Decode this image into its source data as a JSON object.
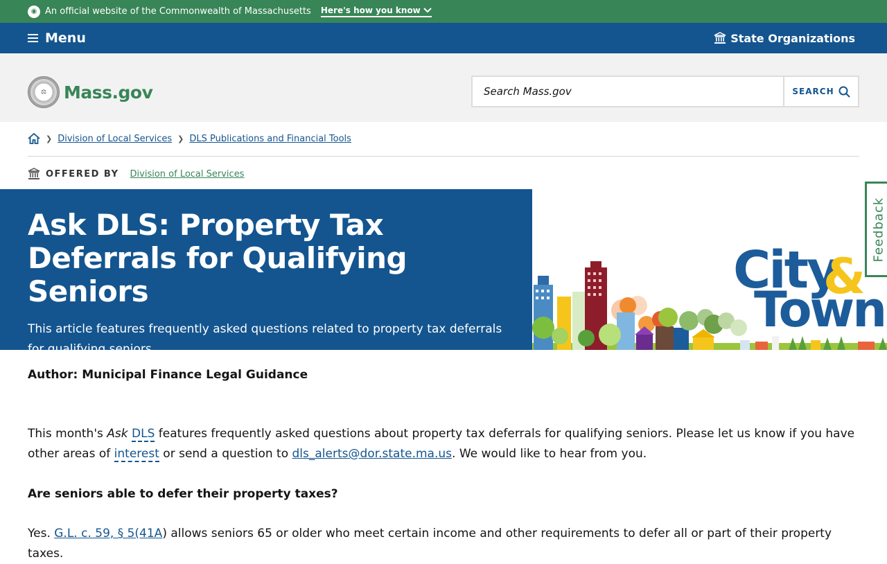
{
  "official_bar": {
    "text": "An official website of the Commonwealth of Massachusetts",
    "how_link": "Here's how you know"
  },
  "menu_bar": {
    "menu_label": "Menu",
    "state_orgs_label": "State Organizations"
  },
  "header": {
    "logo_text": "Mass.gov",
    "search_placeholder": "Search Mass.gov",
    "search_button": "SEARCH"
  },
  "breadcrumb": {
    "items": [
      "Division of Local Services",
      "DLS Publications and Financial Tools"
    ]
  },
  "offered_by": {
    "label": "OFFERED BY",
    "org": "Division of Local Services"
  },
  "banner": {
    "title": "Ask DLS: Property Tax Deferrals for Qualifying Seniors",
    "subtitle": "This article features frequently asked questions related to property tax deferrals for qualifying seniors.",
    "art_line1": "City",
    "art_amp": "&",
    "art_line2": "Town"
  },
  "feedback_label": "Feedback",
  "content": {
    "author": "Author: Municipal Finance Legal Guidance",
    "p1_a": "This month's ",
    "p1_ask": "Ask",
    "p1_dls": "DLS",
    "p1_b": " features frequently asked questions about property tax deferrals for qualifying seniors. Please let us know if you have other areas of ",
    "p1_interest": "interest",
    "p1_c": " or send a question to ",
    "p1_email": "dls_alerts@dor.state.ma.us",
    "p1_d": ". We would like to hear from you.",
    "question": "Are seniors able to defer their property taxes?",
    "p2_a": "Yes. ",
    "p2_link": "G.L. c. 59, § 5(41A",
    "p2_b": ") allows seniors 65 or older who meet certain income and other requirements to defer all or part of their property taxes."
  },
  "colors": {
    "green": "#388557",
    "blue": "#14558f",
    "yellow": "#f6c51b"
  }
}
